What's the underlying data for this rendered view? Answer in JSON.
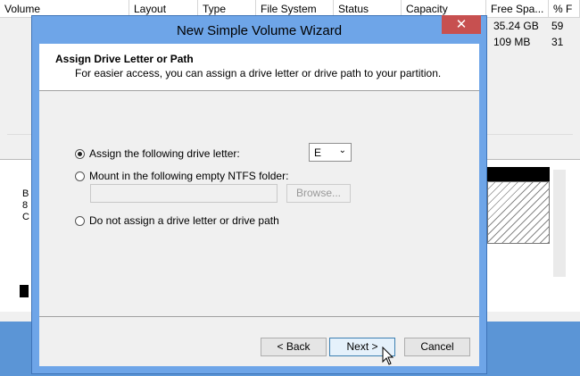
{
  "background": {
    "columns": [
      "Volume",
      "Layout",
      "Type",
      "File System",
      "Status",
      "Capacity",
      "Free Spa...",
      "% F"
    ],
    "rows": [
      {
        "free": "35.24 GB",
        "pct": "59"
      },
      {
        "free": "109 MB",
        "pct": "31"
      }
    ],
    "left_fragments": [
      "B",
      "8",
      "C"
    ]
  },
  "wizard": {
    "title": "New Simple Volume Wizard",
    "close_label": "✕",
    "header_title": "Assign Drive Letter or Path",
    "header_subtitle": "For easier access, you can assign a drive letter or drive path to your partition.",
    "options": {
      "assign_letter": "Assign the following drive letter:",
      "mount_folder": "Mount in the following empty NTFS folder:",
      "no_assign": "Do not assign a drive letter or drive path"
    },
    "drive_letter": "E",
    "browse_label": "Browse...",
    "buttons": {
      "back": "< Back",
      "next": "Next >",
      "cancel": "Cancel"
    }
  }
}
